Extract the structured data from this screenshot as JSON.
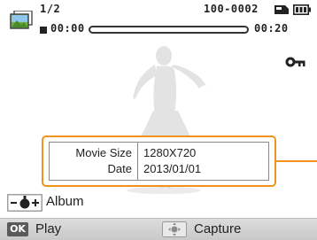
{
  "status": {
    "counter": "1/2",
    "file_number": "100-0002",
    "time_current": "00:00",
    "time_total": "00:20",
    "progress_fraction": 0.0
  },
  "info": {
    "rows": [
      {
        "label": "Movie Size",
        "value": "1280X720"
      },
      {
        "label": "Date",
        "value": "2013/01/01"
      }
    ]
  },
  "hints": {
    "album_label": "Album",
    "ok_key": "OK",
    "play_label": "Play",
    "capture_label": "Capture"
  },
  "icons": {
    "thumbnail": "movie-thumbnail-icon",
    "card": "memory-card-icon",
    "battery": "battery-icon",
    "stop": "stop-icon",
    "protect": "protect-key-icon",
    "zoom": "zoom-lever-icon",
    "navigation": "navigation-button-icon"
  },
  "colors": {
    "accent": "#f0931e",
    "text": "#222222",
    "silhouette": "#e3e3e3"
  }
}
